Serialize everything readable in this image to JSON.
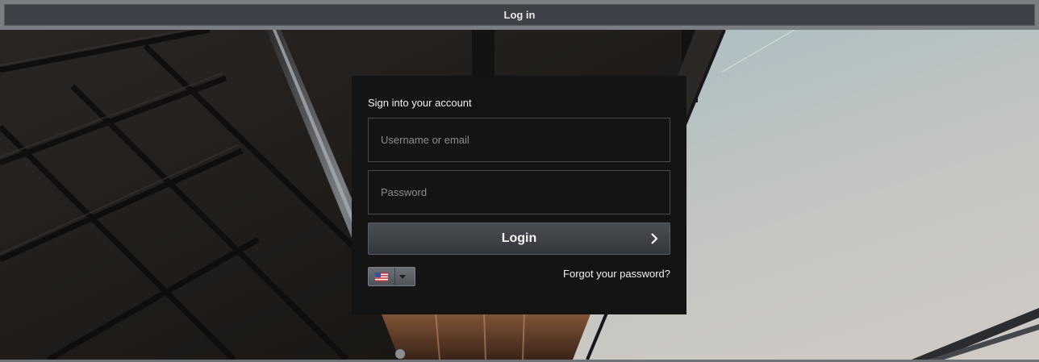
{
  "window": {
    "title": "Log in"
  },
  "login_form": {
    "heading": "Sign into your account",
    "username_placeholder": "Username or email",
    "username_value": "",
    "password_placeholder": "Password",
    "password_value": "",
    "login_label": "Login",
    "login_icon": "chevron-right-icon",
    "forgot_password_label": "Forgot your password?",
    "language": {
      "selected_icon": "us-flag-icon",
      "dropdown_icon": "caret-down-icon"
    }
  },
  "colors": {
    "titlebar": "#3d4046",
    "panel": "#141415",
    "button": "#43464c",
    "sky": "#b9c6c9"
  }
}
